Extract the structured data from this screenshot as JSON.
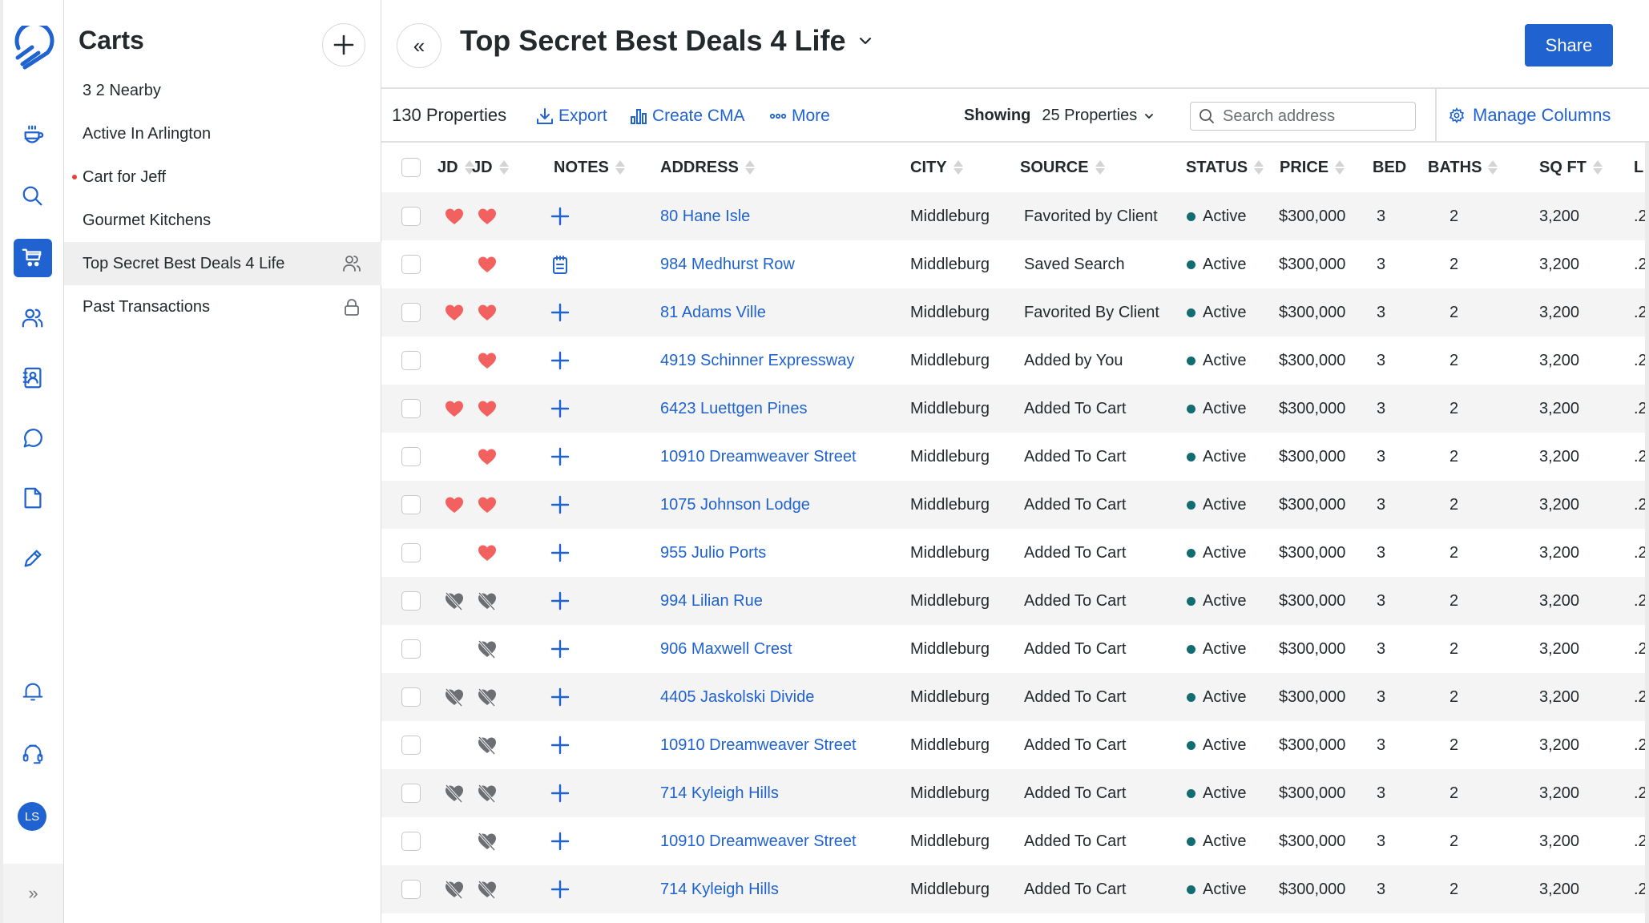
{
  "rail": {
    "items": [
      {
        "name": "coffee",
        "label": "Dashboard"
      },
      {
        "name": "search",
        "label": "Search"
      },
      {
        "name": "cart",
        "label": "Carts",
        "active": true
      },
      {
        "name": "users",
        "label": "Clients"
      },
      {
        "name": "contacts",
        "label": "Contacts"
      },
      {
        "name": "chat",
        "label": "Messages"
      },
      {
        "name": "document",
        "label": "Documents"
      },
      {
        "name": "pencil",
        "label": "Edit"
      }
    ],
    "bottom": [
      {
        "name": "bell",
        "label": "Notifications"
      },
      {
        "name": "headset",
        "label": "Support"
      }
    ],
    "avatar_initials": "LS",
    "expand_glyph": "»"
  },
  "carts": {
    "title": "Carts",
    "items": [
      {
        "label": "3 2 Nearby"
      },
      {
        "label": "Active In Arlington"
      },
      {
        "label": "Cart for Jeff",
        "unread": true
      },
      {
        "label": "Gourmet Kitchens"
      },
      {
        "label": "Top Secret Best Deals 4 Life",
        "selected": true,
        "icon": "shared-users"
      },
      {
        "label": "Past Transactions",
        "icon": "lock"
      }
    ]
  },
  "header": {
    "collapse_glyph": "«",
    "title": "Top Secret Best Deals 4 Life",
    "share_label": "Share"
  },
  "toolbar": {
    "count": "130 Properties",
    "export": "Export",
    "create_cma": "Create CMA",
    "more": "More",
    "showing_label": "Showing",
    "showing_value": "25 Properties",
    "search_placeholder": "Search address",
    "manage_columns": "Manage Columns"
  },
  "table": {
    "columns": [
      "JD",
      "JD",
      "NOTES",
      "ADDRESS",
      "CITY",
      "SOURCE",
      "STATUS",
      "PRICE",
      "BED",
      "BATHS",
      "SQ FT",
      "L"
    ],
    "rows": [
      {
        "jd1": "fav",
        "jd2": "fav",
        "note": "add",
        "address": "80 Hane Isle",
        "city": "Middleburg",
        "source": "Favorited by Client",
        "status": "Active",
        "price": "$300,000",
        "bed": "3",
        "baths": "2",
        "sqft": "3,200",
        "lot": ".2"
      },
      {
        "jd1": "none",
        "jd2": "fav",
        "note": "note",
        "address": "984 Medhurst Row",
        "city": "Middleburg",
        "source": "Saved Search",
        "status": "Active",
        "price": "$300,000",
        "bed": "3",
        "baths": "2",
        "sqft": "3,200",
        "lot": ".2"
      },
      {
        "jd1": "fav",
        "jd2": "fav",
        "note": "add",
        "address": "81 Adams Ville",
        "city": "Middleburg",
        "source": "Favorited By Client",
        "status": "Active",
        "price": "$300,000",
        "bed": "3",
        "baths": "2",
        "sqft": "3,200",
        "lot": ".2"
      },
      {
        "jd1": "none",
        "jd2": "fav",
        "note": "add",
        "address": "4919 Schinner Expressway",
        "city": "Middleburg",
        "source": "Added by You",
        "status": "Active",
        "price": "$300,000",
        "bed": "3",
        "baths": "2",
        "sqft": "3,200",
        "lot": ".2"
      },
      {
        "jd1": "fav",
        "jd2": "fav",
        "note": "add",
        "address": "6423 Luettgen Pines",
        "city": "Middleburg",
        "source": "Added To Cart",
        "status": "Active",
        "price": "$300,000",
        "bed": "3",
        "baths": "2",
        "sqft": "3,200",
        "lot": ".2"
      },
      {
        "jd1": "none",
        "jd2": "fav",
        "note": "add",
        "address": "10910 Dreamweaver Street",
        "city": "Middleburg",
        "source": "Added To Cart",
        "status": "Active",
        "price": "$300,000",
        "bed": "3",
        "baths": "2",
        "sqft": "3,200",
        "lot": ".2"
      },
      {
        "jd1": "fav",
        "jd2": "fav",
        "note": "add",
        "address": "1075 Johnson Lodge",
        "city": "Middleburg",
        "source": "Added To Cart",
        "status": "Active",
        "price": "$300,000",
        "bed": "3",
        "baths": "2",
        "sqft": "3,200",
        "lot": ".2"
      },
      {
        "jd1": "none",
        "jd2": "fav",
        "note": "add",
        "address": "955 Julio Ports",
        "city": "Middleburg",
        "source": "Added To Cart",
        "status": "Active",
        "price": "$300,000",
        "bed": "3",
        "baths": "2",
        "sqft": "3,200",
        "lot": ".2"
      },
      {
        "jd1": "unfav",
        "jd2": "unfav",
        "note": "add",
        "address": "994 Lilian Rue",
        "city": "Middleburg",
        "source": "Added To Cart",
        "status": "Active",
        "price": "$300,000",
        "bed": "3",
        "baths": "2",
        "sqft": "3,200",
        "lot": ".2"
      },
      {
        "jd1": "none",
        "jd2": "unfav",
        "note": "add",
        "address": "906 Maxwell Crest",
        "city": "Middleburg",
        "source": "Added To Cart",
        "status": "Active",
        "price": "$300,000",
        "bed": "3",
        "baths": "2",
        "sqft": "3,200",
        "lot": ".2"
      },
      {
        "jd1": "unfav",
        "jd2": "unfav",
        "note": "add",
        "address": "4405 Jaskolski Divide",
        "city": "Middleburg",
        "source": "Added To Cart",
        "status": "Active",
        "price": "$300,000",
        "bed": "3",
        "baths": "2",
        "sqft": "3,200",
        "lot": ".2"
      },
      {
        "jd1": "none",
        "jd2": "unfav",
        "note": "add",
        "address": "10910 Dreamweaver Street",
        "city": "Middleburg",
        "source": "Added To Cart",
        "status": "Active",
        "price": "$300,000",
        "bed": "3",
        "baths": "2",
        "sqft": "3,200",
        "lot": ".2"
      },
      {
        "jd1": "unfav",
        "jd2": "unfav",
        "note": "add",
        "address": "714 Kyleigh Hills",
        "city": "Middleburg",
        "source": "Added To Cart",
        "status": "Active",
        "price": "$300,000",
        "bed": "3",
        "baths": "2",
        "sqft": "3,200",
        "lot": ".2"
      },
      {
        "jd1": "none",
        "jd2": "unfav",
        "note": "add",
        "address": "10910 Dreamweaver Street",
        "city": "Middleburg",
        "source": "Added To Cart",
        "status": "Active",
        "price": "$300,000",
        "bed": "3",
        "baths": "2",
        "sqft": "3,200",
        "lot": ".2"
      },
      {
        "jd1": "unfav",
        "jd2": "unfav",
        "note": "add",
        "address": "714 Kyleigh Hills",
        "city": "Middleburg",
        "source": "Added To Cart",
        "status": "Active",
        "price": "$300,000",
        "bed": "3",
        "baths": "2",
        "sqft": "3,200",
        "lot": ".2"
      }
    ]
  },
  "colors": {
    "brand": "#1f62d0",
    "favorite": "#f2605f",
    "unfavorite": "#6b6e72",
    "status_active": "#136c72",
    "row_shade": "#f4f4f4"
  }
}
